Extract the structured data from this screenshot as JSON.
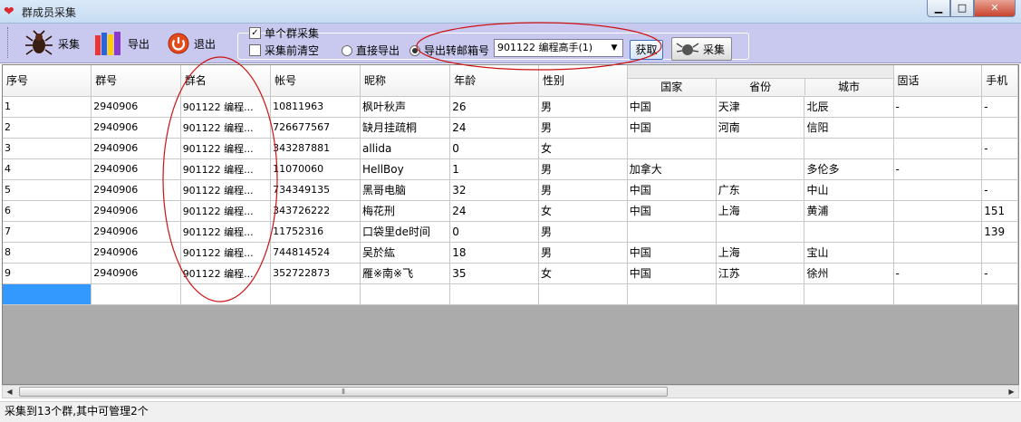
{
  "window": {
    "title": "群成员采集"
  },
  "toolbar": {
    "collect_label": "采集",
    "export_label": "导出",
    "exit_label": "退出",
    "single_group_label": "单个群采集",
    "single_group_checked": true,
    "clear_before_label": "采集前清空",
    "clear_before_checked": false,
    "direct_export_label": "直接导出",
    "export_email_label": "导出转邮箱号",
    "export_mode_selected": "export_email",
    "group_select_value": "901122 编程高手(1)",
    "fetch_label": "获取",
    "collect2_label": "采集"
  },
  "table": {
    "headers": {
      "seq": "序号",
      "group_no": "群号",
      "group_name": "群名",
      "account": "帐号",
      "nickname": "昵称",
      "age": "年龄",
      "gender": "性别",
      "country": "国家",
      "province": "省份",
      "city": "城市",
      "phone": "固话",
      "mobile": "手机"
    },
    "rows": [
      [
        "1",
        "2940906",
        "901122 编程...",
        "10811963",
        "枫叶秋声",
        "26",
        "男",
        "中国",
        "天津",
        "北辰",
        "-",
        "-"
      ],
      [
        "2",
        "2940906",
        "901122 编程...",
        "726677567",
        "缺月挂疏桐",
        "24",
        "男",
        "中国",
        "河南",
        "信阳",
        "",
        ""
      ],
      [
        "3",
        "2940906",
        "901122 编程...",
        "343287881",
        "allida",
        "0",
        "女",
        "",
        "",
        "",
        "",
        "-"
      ],
      [
        "4",
        "2940906",
        "901122 编程...",
        "11070060",
        "HellBoy",
        "1",
        "男",
        "加拿大",
        "",
        "多伦多",
        "-",
        ""
      ],
      [
        "5",
        "2940906",
        "901122 编程...",
        "734349135",
        "黑哥电脑",
        "32",
        "男",
        "中国",
        "广东",
        "中山",
        "",
        "-"
      ],
      [
        "6",
        "2940906",
        "901122 编程...",
        "343726222",
        "梅花刑",
        "24",
        "女",
        "中国",
        "上海",
        "黄浦",
        "",
        "151"
      ],
      [
        "7",
        "2940906",
        "901122 编程...",
        "11752316",
        "口袋里de时间",
        "0",
        "男",
        "",
        "",
        "",
        "",
        "139"
      ],
      [
        "8",
        "2940906",
        "901122 编程...",
        "744814524",
        "吴於紘",
        "18",
        "男",
        "中国",
        "上海",
        "宝山",
        "",
        ""
      ],
      [
        "9",
        "2940906",
        "901122 编程...",
        "352722873",
        "雁※南※飞",
        "35",
        "女",
        "中国",
        "江苏",
        "徐州",
        "-",
        "-"
      ]
    ]
  },
  "scrollbar": {
    "thumb_glyph": "⦀"
  },
  "status": {
    "text": "采集到13个群,其中可管理2个"
  },
  "colors": {
    "toolbar": "#c9c9f0",
    "selection": "#3399ff",
    "annotation": "#cc1111"
  },
  "icons": [
    "heart-icon",
    "bug-icon",
    "books-icon",
    "power-icon",
    "bug-small-icon"
  ]
}
